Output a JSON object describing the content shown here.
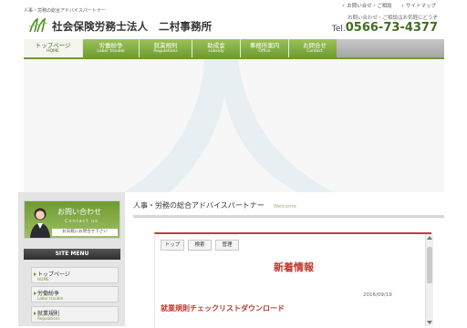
{
  "header": {
    "tagline": "人事・労務の総合アドバイスパートナー",
    "brand": "社会保険労務士法人　二村事務所",
    "top_links": [
      "お問い合せ・ご相談",
      "サイトマップ"
    ],
    "contact_note": "お問い合わせ・ご相談はお気軽にどうぞ",
    "tel_prefix": "Tel.",
    "tel_number": "0566-73-4377"
  },
  "nav": {
    "items": [
      {
        "jp": "トップページ",
        "en": "HOME"
      },
      {
        "jp": "労働紛争",
        "en": "Labor trouble"
      },
      {
        "jp": "就業規則",
        "en": "Regulations"
      },
      {
        "jp": "助成金",
        "en": "subsidy"
      },
      {
        "jp": "事務所案内",
        "en": "Office"
      },
      {
        "jp": "お問合せ",
        "en": "Contact"
      }
    ]
  },
  "sidebar": {
    "contact_title": "お問い合わせ",
    "contact_en": "Contact us",
    "contact_cta": "お気軽にお問合せ下さい",
    "site_menu": "SITE MENU",
    "menu": [
      {
        "jp": "トップページ",
        "en": "HOME"
      },
      {
        "jp": "労働紛争",
        "en": "Labor trouble"
      },
      {
        "jp": "就業規則",
        "en": "Regulations"
      }
    ]
  },
  "main": {
    "title": "人事・労務の総合アドバイスパートナー",
    "welcome": "Welcome",
    "buttons": [
      "トップ",
      "検索",
      "管理"
    ],
    "news_title": "新着情報",
    "news_date": "2016/09/19",
    "news_item": "就業規則チェックリストダウンロード"
  },
  "colors": {
    "accent_green": "#6f9b31",
    "accent_red": "#c0352a"
  }
}
